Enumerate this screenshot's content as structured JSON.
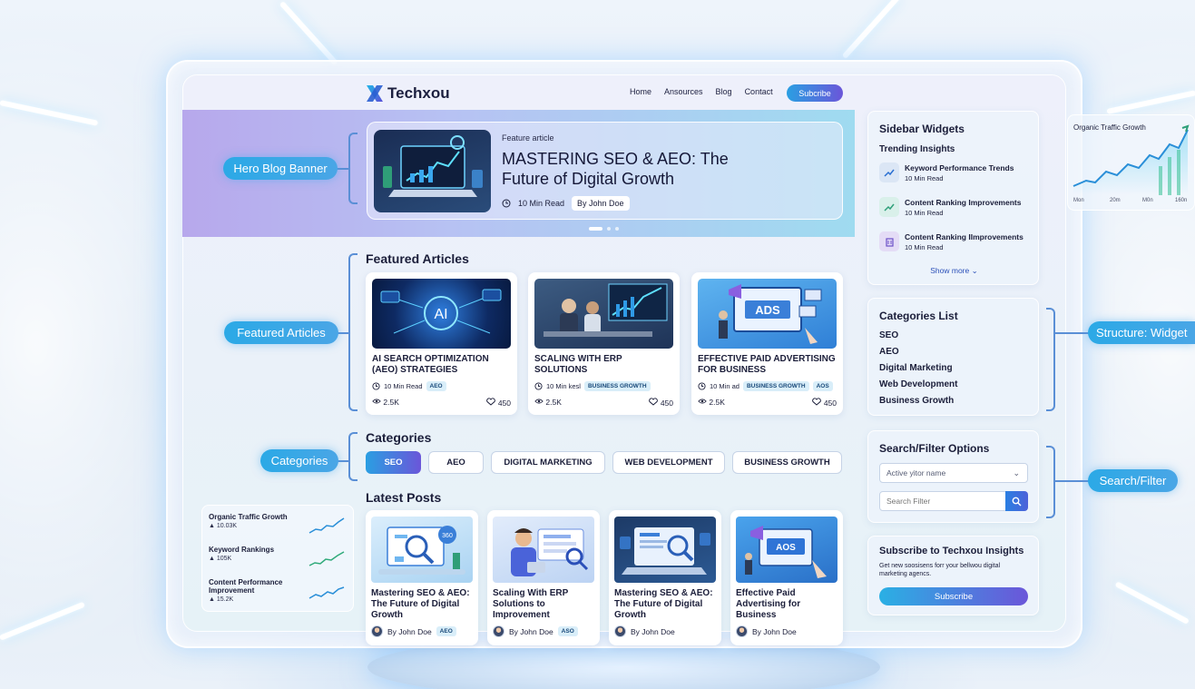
{
  "brand": {
    "name": "Techxou"
  },
  "nav": {
    "items": [
      "Home",
      "Ansources",
      "Blog",
      "Contact"
    ],
    "subscribe": "Subcribe"
  },
  "hero": {
    "kicker": "Feature article",
    "title": "MASTERING SEO & AEO: The Future of Digital Growth",
    "read_time": "10 Min Read",
    "author": "By John Doe"
  },
  "featured": {
    "heading": "Featured Articles",
    "cards": [
      {
        "title": "AI SEARCH OPTIMIZATION (AEO) STRATEGIES",
        "read": "10 Min Read",
        "tags": [
          "AEO"
        ],
        "views": "2.5K",
        "likes": "450",
        "img_text": "AI"
      },
      {
        "title": "SCALING WITH ERP SOLUTIONS",
        "read": "10 Min kesl",
        "tags": [
          "BUSINESS GROWTH"
        ],
        "views": "2.5K",
        "likes": "450",
        "img_text": ""
      },
      {
        "title": "EFFECTIVE PAID ADVERTISING FOR BUSINESS",
        "read": "10 Min ad",
        "tags": [
          "BUSINESS GROWTH",
          "AOS"
        ],
        "views": "2.5K",
        "likes": "450",
        "img_text": "ADS"
      }
    ]
  },
  "categories": {
    "heading": "Categories",
    "items": [
      "SEO",
      "AEO",
      "DIGITAL MARKETING",
      "WEB DEVELOPMENT",
      "BUSINESS GROWTH"
    ],
    "active": "SEO"
  },
  "latest": {
    "heading": "Latest Posts",
    "posts": [
      {
        "title": "Mastering SEO & AEO: The Future of Digital Growth",
        "author": "By John Doe",
        "tag": "AEO",
        "img_text": "360"
      },
      {
        "title": "Scaling With ERP Solutions to Improvement",
        "author": "By John Doe",
        "tag": "ASO",
        "img_text": ""
      },
      {
        "title": "Mastering SEO & AEO: The Future of Digital Growth",
        "author": "By John Doe",
        "tag": "",
        "img_text": ""
      },
      {
        "title": "Effective Paid Advertising for Business",
        "author": "By John Doe",
        "tag": "",
        "img_text": "AOS"
      }
    ]
  },
  "callouts": {
    "hero": "Hero Blog Banner",
    "featured": "Featured Articles",
    "categories": "Categories",
    "structure": "Structure: Widget",
    "search": "Search/Filter"
  },
  "sidebar": {
    "widgets_title": "Sidebar Widgets",
    "trending_title": "Trending Insights",
    "trending": [
      {
        "title": "Keyword Performance Trends",
        "meta": "10 Min Read",
        "icon": "trend-icon"
      },
      {
        "title": "Content Ranking Improvements",
        "meta": "10 Min Read",
        "icon": "trend-icon"
      },
      {
        "title": "Content Ranking IImprovements",
        "meta": "10 Min Read",
        "icon": "building-icon"
      }
    ],
    "show_more": "Show more",
    "categories_title": "Categories List",
    "categories": [
      "SEO",
      "AEO",
      "Digital Marketing",
      "Web Development",
      "Business Growth"
    ],
    "search_title": "Search/Filter Options",
    "select_value": "Active yitor name",
    "search_placeholder": "Search Filter",
    "subscribe_title": "Subscribe to Techxou Insights",
    "subscribe_text": "Get new soosisens forr your bellwou digital marketing agencs.",
    "subscribe_button": "Subscribe"
  },
  "left_stats": [
    {
      "label": "Organic Traffic Growth",
      "value": "10.03K"
    },
    {
      "label": "Keyword Rankings",
      "value": "105K"
    },
    {
      "label": "Content Performance Improvement",
      "value": "15.2K"
    }
  ],
  "right_chart": {
    "title": "Organic Traffic Growth",
    "x_labels": [
      "Mon",
      "20m",
      "M0n",
      "160n"
    ]
  },
  "colors": {
    "accent_start": "#2a9fe2",
    "accent_end": "#6b56d9",
    "text": "#1b1e3a"
  }
}
